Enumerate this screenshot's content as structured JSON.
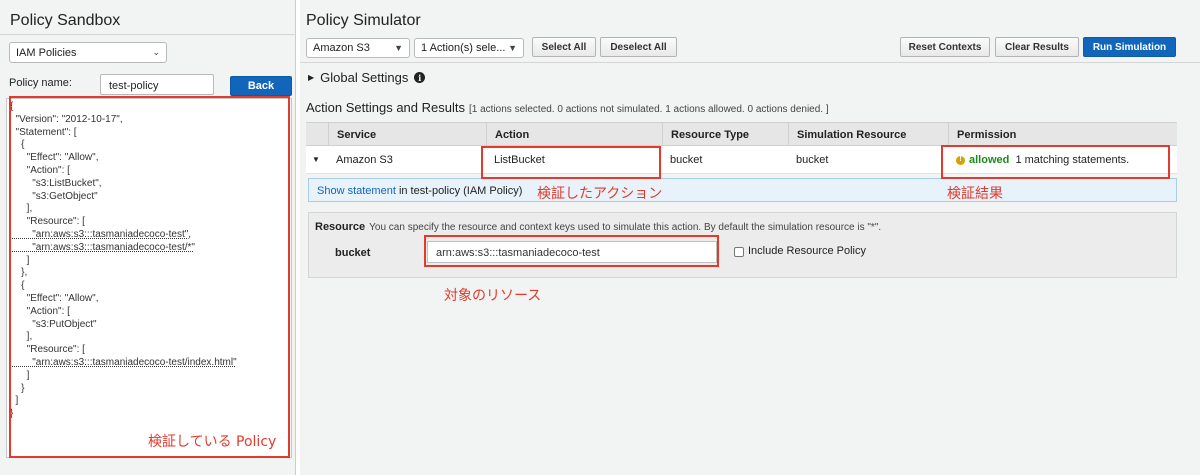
{
  "sandbox": {
    "title": "Policy Sandbox",
    "policy_type": "IAM Policies",
    "policy_name_label": "Policy name:",
    "policy_name_value": "test-policy",
    "back_label": "Back",
    "policy_lines": [
      "{",
      "  \"Version\": \"2012-10-17\",",
      "  \"Statement\": [",
      "    {",
      "      \"Effect\": \"Allow\",",
      "      \"Action\": [",
      "        \"s3:ListBucket\",",
      "        \"s3:GetObject\"",
      "      ],",
      "      \"Resource\": [",
      "        \"arn:aws:s3:::tasmaniadecoco-test\",",
      "        \"arn:aws:s3:::tasmaniadecoco-test/*\"",
      "      ]",
      "    },",
      "    {",
      "      \"Effect\": \"Allow\",",
      "      \"Action\": [",
      "        \"s3:PutObject\"",
      "      ],",
      "      \"Resource\": [",
      "        \"arn:aws:s3:::tasmaniadecoco-test/index.html\"",
      "      ]",
      "    }",
      "  ]",
      "}"
    ]
  },
  "simulator": {
    "title": "Policy Simulator",
    "service_select": "Amazon S3",
    "action_select": "1 Action(s) sele...",
    "select_all": "Select All",
    "deselect_all": "Deselect All",
    "reset_contexts": "Reset Contexts",
    "clear_results": "Clear Results",
    "run_simulation": "Run Simulation",
    "global_settings": "Global Settings",
    "action_settings_title": "Action Settings and Results",
    "action_settings_summary": "[1 actions selected. 0 actions not simulated. 1 actions allowed. 0 actions denied. ]",
    "columns": [
      "Service",
      "Action",
      "Resource Type",
      "Simulation Resource",
      "Permission"
    ],
    "row": {
      "service": "Amazon S3",
      "action": "ListBucket",
      "resource_type": "bucket",
      "simulation_resource": "bucket",
      "permission": "allowed",
      "matching": "1 matching statements."
    },
    "statement_link": "Show statement",
    "statement_rest": "in test-policy (IAM Policy)",
    "resource_label": "Resource",
    "resource_hint": "You can specify the resource and context keys used to simulate this action. By default the simulation resource is \"*\".",
    "resource_key": "bucket",
    "resource_value": "arn:aws:s3:::tasmaniadecoco-test",
    "include_resource_policy": "Include Resource Policy"
  },
  "annotations": {
    "policy": "検証している Policy",
    "action": "検証したアクション",
    "result": "検証結果",
    "resource": "対象のリソース"
  },
  "colors": {
    "annotation_red": "#e23b2e",
    "primary_blue": "#1166bb",
    "allowed_green": "#1e8a1e"
  }
}
